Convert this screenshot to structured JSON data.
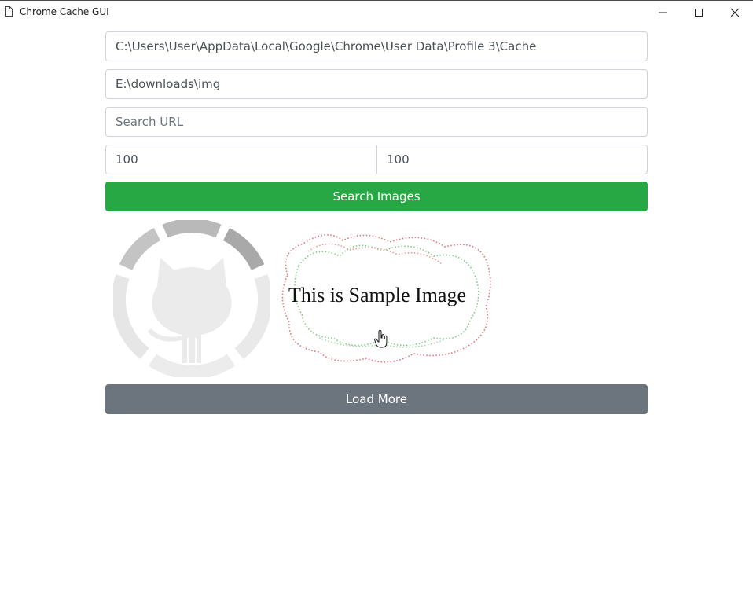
{
  "window": {
    "title": "Chrome Cache GUI"
  },
  "form": {
    "cache_path_value": "C:\\Users\\User\\AppData\\Local\\Google\\Chrome\\User Data\\Profile 3\\Cache",
    "output_path_value": "E:\\downloads\\img",
    "search_url_placeholder": "Search URL",
    "width_value": "100",
    "height_value": "100",
    "search_button_label": "Search Images"
  },
  "results": {
    "images": [
      {
        "icon": "github-octocat-logo"
      },
      {
        "caption": "This is Sample Image"
      }
    ]
  },
  "load_more_label": "Load More",
  "colors": {
    "success": "#28a745",
    "secondary": "#6c757d",
    "border": "#ced4da"
  }
}
